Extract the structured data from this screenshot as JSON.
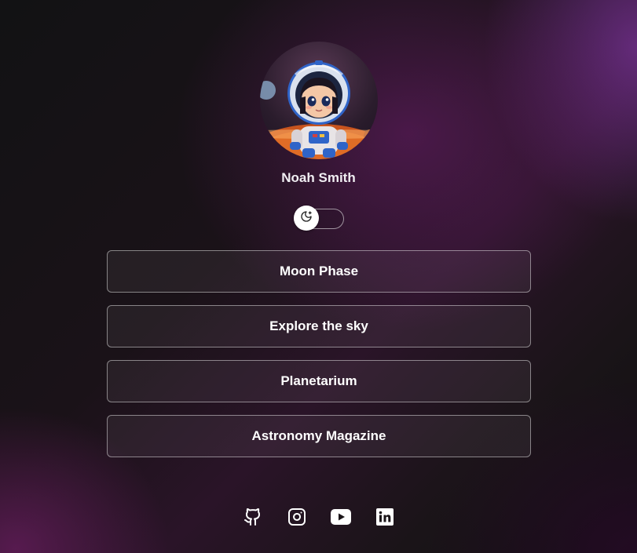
{
  "profile": {
    "name": "Noah Smith",
    "avatar_icon": "astronaut-avatar"
  },
  "theme_toggle": {
    "icon": "moon-icon",
    "state": "dark"
  },
  "links": [
    {
      "label": "Moon Phase"
    },
    {
      "label": "Explore the sky"
    },
    {
      "label": "Planetarium"
    },
    {
      "label": "Astronomy Magazine"
    }
  ],
  "socials": [
    {
      "icon": "github-icon"
    },
    {
      "icon": "instagram-icon"
    },
    {
      "icon": "youtube-icon"
    },
    {
      "icon": "linkedin-icon"
    }
  ],
  "colors": {
    "background_dark": "#121214",
    "background_purple": "#6e1e6e",
    "text": "#ffffff",
    "helmet_blue": "#2f64c8",
    "planet_orange": "#e8762a"
  }
}
